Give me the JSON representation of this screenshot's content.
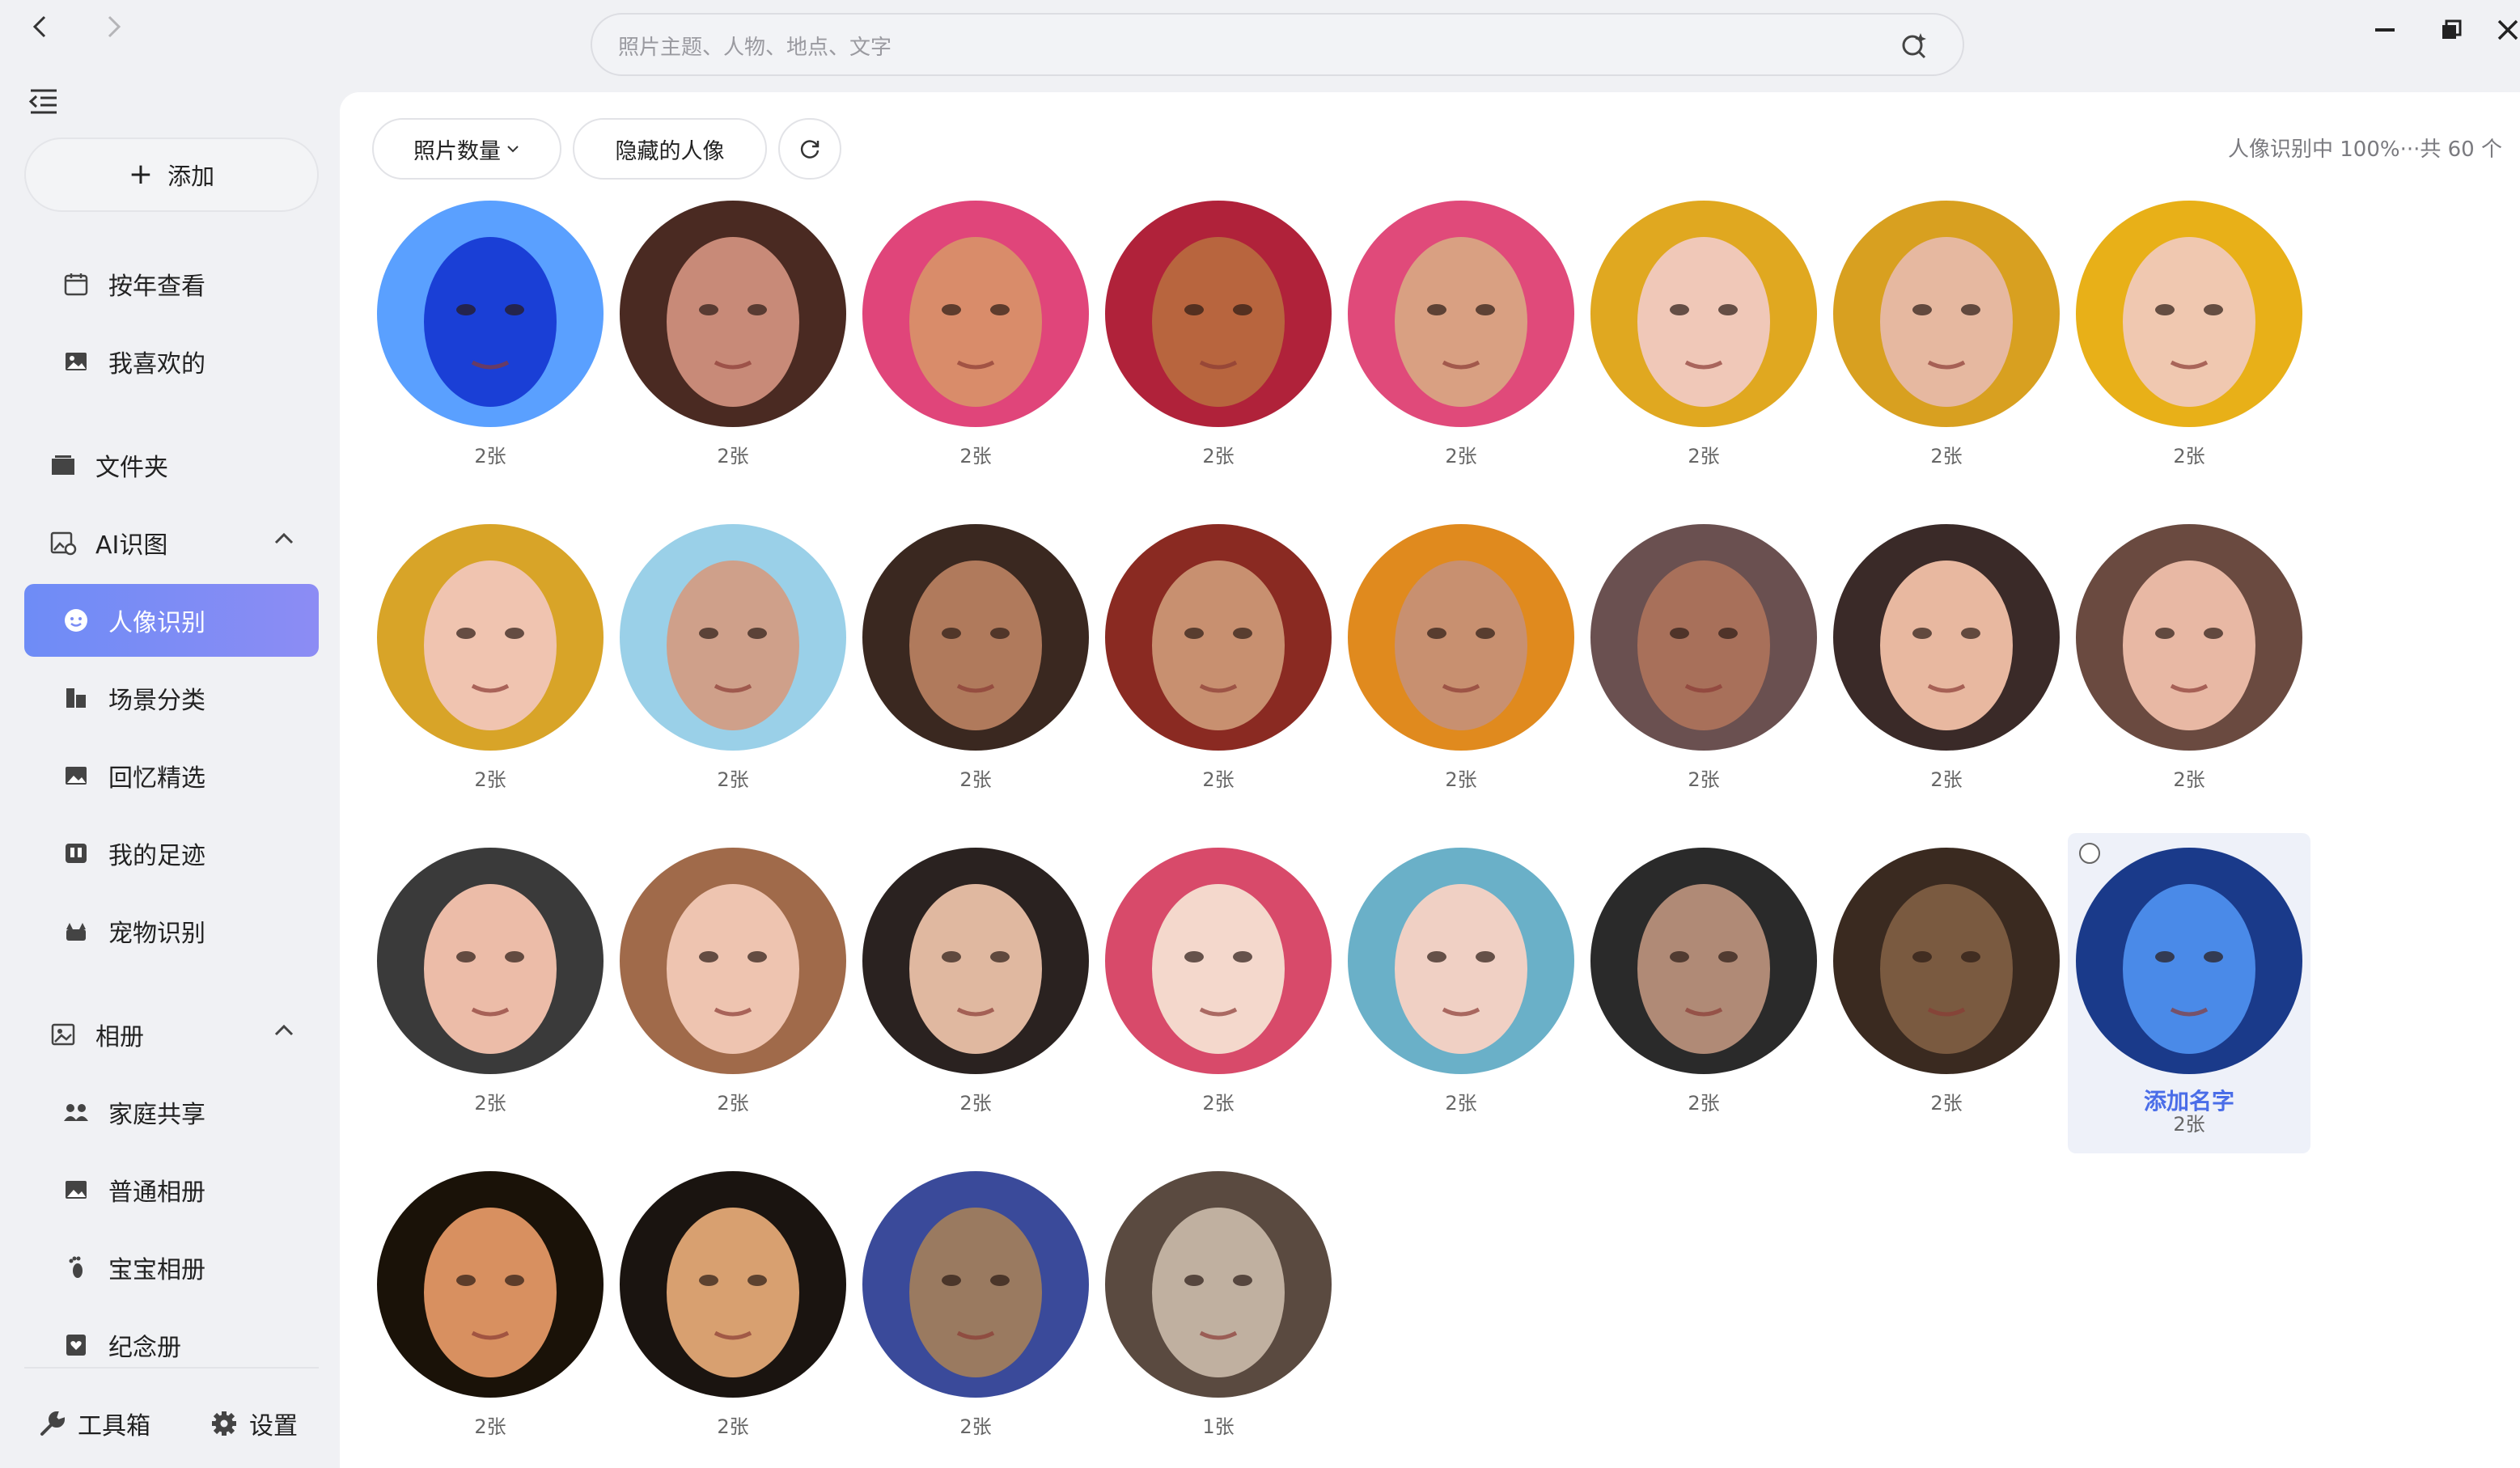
{
  "search": {
    "placeholder": "照片主题、人物、地点、文字"
  },
  "sidebar": {
    "add_label": "添加",
    "items": [
      {
        "label": "按年查看",
        "icon": "calendar-icon"
      },
      {
        "label": "我喜欢的",
        "icon": "image-icon"
      },
      {
        "label": "文件夹",
        "icon": "folder-icon"
      },
      {
        "label": "AI识图",
        "icon": "ai-image-icon"
      },
      {
        "label": "人像识别",
        "icon": "face-icon"
      },
      {
        "label": "场景分类",
        "icon": "scene-icon"
      },
      {
        "label": "回忆精选",
        "icon": "memory-icon"
      },
      {
        "label": "我的足迹",
        "icon": "map-icon"
      },
      {
        "label": "宠物识别",
        "icon": "pet-icon"
      },
      {
        "label": "相册",
        "icon": "album-icon"
      },
      {
        "label": "家庭共享",
        "icon": "family-icon"
      },
      {
        "label": "普通相册",
        "icon": "picture-icon"
      },
      {
        "label": "宝宝相册",
        "icon": "footprint-icon"
      },
      {
        "label": "纪念册",
        "icon": "heart-book-icon"
      }
    ],
    "tools_label": "工具箱",
    "settings_label": "设置"
  },
  "toolbar": {
    "sort_label": "照片数量",
    "hidden_label": "隐藏的人像",
    "status_text": "人像识别中 100%···共 60 个"
  },
  "people": [
    {
      "count": "2张",
      "colors": [
        "#1a3fd6",
        "#5aa0ff"
      ]
    },
    {
      "count": "2张",
      "colors": [
        "#c88a78",
        "#4a2a22"
      ]
    },
    {
      "count": "2张",
      "colors": [
        "#d98c6a",
        "#e0457a"
      ]
    },
    {
      "count": "2张",
      "colors": [
        "#b8653e",
        "#b0223a"
      ]
    },
    {
      "count": "2张",
      "colors": [
        "#d9a082",
        "#e04a7a"
      ]
    },
    {
      "count": "2张",
      "colors": [
        "#f0c8b8",
        "#e0a820"
      ]
    },
    {
      "count": "2张",
      "colors": [
        "#e6b8a0",
        "#d8a020"
      ]
    },
    {
      "count": "2张",
      "colors": [
        "#f0c8b0",
        "#e8b018"
      ]
    },
    {
      "count": "2张",
      "colors": [
        "#f0c4b0",
        "#d8a428"
      ]
    },
    {
      "count": "2张",
      "colors": [
        "#cfa08a",
        "#9ad0e8"
      ]
    },
    {
      "count": "2张",
      "colors": [
        "#b07a5c",
        "#3a2820"
      ]
    },
    {
      "count": "2张",
      "colors": [
        "#c89070",
        "#8a2a22"
      ]
    },
    {
      "count": "2张",
      "colors": [
        "#c89070",
        "#e08a1e"
      ]
    },
    {
      "count": "2张",
      "colors": [
        "#a8705a",
        "#6a5050"
      ]
    },
    {
      "count": "2张",
      "colors": [
        "#e8b8a0",
        "#3a2a28"
      ]
    },
    {
      "count": "2张",
      "colors": [
        "#e8b8a4",
        "#6a4a40"
      ]
    },
    {
      "count": "2张",
      "colors": [
        "#ecbca8",
        "#3a3a3a"
      ]
    },
    {
      "count": "2张",
      "colors": [
        "#eec4b0",
        "#a06a4a"
      ]
    },
    {
      "count": "2张",
      "colors": [
        "#e0b8a0",
        "#2a2220"
      ]
    },
    {
      "count": "2张",
      "colors": [
        "#f4d8cc",
        "#d84a6a"
      ]
    },
    {
      "count": "2张",
      "colors": [
        "#f0d0c4",
        "#6ab0c8"
      ]
    },
    {
      "count": "2张",
      "colors": [
        "#b08a76",
        "#2a2a2a"
      ]
    },
    {
      "count": "2张",
      "colors": [
        "#7a5a40",
        "#3a2a20"
      ]
    },
    {
      "count": "2张",
      "colors": [
        "#4a8ae8",
        "#1a3a8a"
      ],
      "name_label": "添加名字"
    },
    {
      "count": "2张",
      "colors": [
        "#d89060",
        "#1a1208"
      ]
    },
    {
      "count": "2张",
      "colors": [
        "#d8a070",
        "#1a1410"
      ]
    },
    {
      "count": "2张",
      "colors": [
        "#9a7a60",
        "#3a4a9a"
      ]
    },
    {
      "count": "1张",
      "colors": [
        "#c0b0a0",
        "#5a4a40"
      ]
    }
  ]
}
